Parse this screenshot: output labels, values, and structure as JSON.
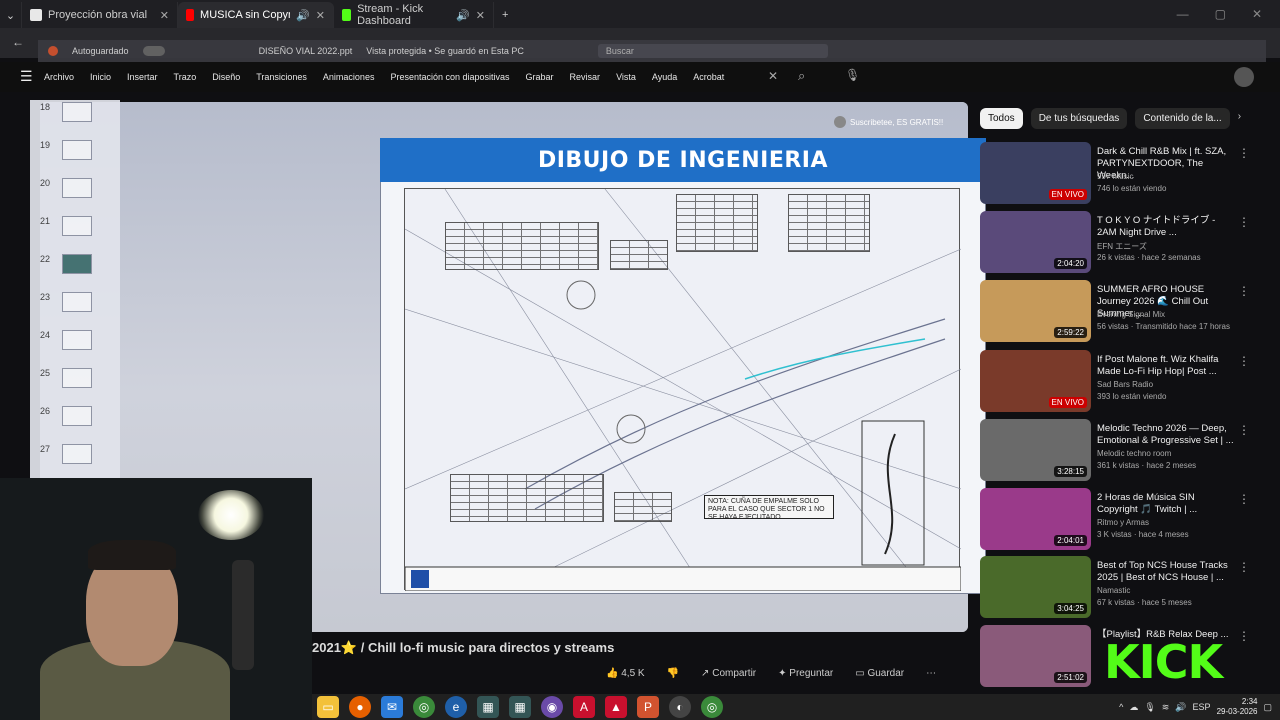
{
  "tabs": [
    {
      "label": "Proyección obra vial",
      "favicon_color": "#e8e8e8"
    },
    {
      "label": "MUSICA sin Copyright para",
      "favicon_color": "#ff0000"
    },
    {
      "label": "Stream - Kick Dashboard",
      "favicon_color": "#53fc18"
    }
  ],
  "ppt": {
    "autosave": "Autoguardado",
    "doc_title": "DISEÑO VIAL 2022.ppt",
    "doc_status": "Vista protegida • Se guardó en Esta PC",
    "search_placeholder": "Buscar",
    "ribbon": [
      "Archivo",
      "Inicio",
      "Insertar",
      "Trazo",
      "Diseño",
      "Transiciones",
      "Animaciones",
      "Presentación con diapositivas",
      "Grabar",
      "Revisar",
      "Vista",
      "Ayuda",
      "Acrobat"
    ]
  },
  "slides": [
    "18",
    "19",
    "20",
    "21",
    "22",
    "23",
    "24",
    "25",
    "26",
    "27"
  ],
  "slide": {
    "title": "DIBUJO DE INGENIERIA",
    "nota": "NOTA: CUÑA DE EMPALME SOLO PARA EL CASO QUE SECTOR 1 NO SE HAYA EJECUTADO"
  },
  "subscribe_label": "Suscribetee, ES GRATIS!!",
  "video": {
    "title": "2021⭐ / Chill lo-fi music para directos y streams",
    "likes": "4,5 K",
    "share": "Compartir",
    "ask": "Preguntar",
    "save": "Guardar"
  },
  "chips": [
    "Todos",
    "De tus búsquedas",
    "Contenido de la..."
  ],
  "recommendations": [
    {
      "title": "Dark & Chill R&B Mix | ft. SZA, PARTYNEXTDOOR, The Weekn...",
      "channel": "997 Music",
      "meta": "746 lo están viendo",
      "badge": "EN VIVO",
      "live": true,
      "color": "#3a3f60"
    },
    {
      "title": "T O K Y O ナイトドライブ - 2AM Night Drive ...",
      "channel": "EFN エニーズ",
      "meta": "26 k vistas · hace 2 semanas",
      "badge": "2:04:20",
      "live": false,
      "color": "#5a4a7a"
    },
    {
      "title": "SUMMER AFRO HOUSE Journey 2026 🌊 Chill Out Summer ...",
      "channel": "Evening Signal Mix",
      "meta": "56 vistas · Transmitido hace 17 horas",
      "badge": "2:59:22",
      "live": false,
      "color": "#c69a5a"
    },
    {
      "title": "If Post Malone ft. Wiz Khalifa Made Lo-Fi Hip Hop| Post ...",
      "channel": "Sad Bars Radio",
      "meta": "393 lo están viendo",
      "badge": "EN VIVO",
      "live": true,
      "color": "#7a3a2a"
    },
    {
      "title": "Melodic Techno 2026 — Deep, Emotional & Progressive Set | ...",
      "channel": "Melodic techno room",
      "meta": "361 k vistas · hace 2 meses",
      "badge": "3:28:15",
      "live": false,
      "color": "#6a6a6a"
    },
    {
      "title": "2 Horas de Música SIN Copyright 🎵 Twitch | ...",
      "channel": "Ritmo y Armas",
      "meta": "3 K vistas · hace 4 meses",
      "badge": "2:04:01",
      "live": false,
      "color": "#9a3a8a"
    },
    {
      "title": "Best of Top NCS House Tracks 2025 | Best of NCS House | ...",
      "channel": "Namastic",
      "meta": "67 k vistas · hace 5 meses",
      "badge": "3:04:25",
      "live": false,
      "color": "#4a6a2a"
    },
    {
      "title": "【Playlist】R&B Relax Deep ...",
      "channel": "",
      "meta": "",
      "badge": "2:51:02",
      "live": false,
      "color": "#8a5a7a"
    }
  ],
  "kick_logo": "KICK",
  "taskbar": {
    "lang": "ESP",
    "time": "2:34",
    "date": "29-03-2026"
  }
}
